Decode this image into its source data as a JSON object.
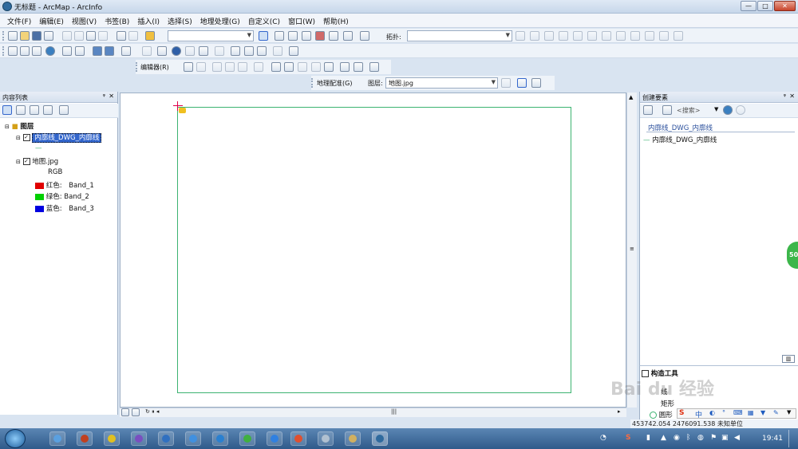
{
  "window": {
    "title": "无标题 - ArcMap - ArcInfo",
    "min_label": "—",
    "max_label": "□",
    "close_label": "✕"
  },
  "menu": [
    "文件(F)",
    "编辑(E)",
    "视图(V)",
    "书签(B)",
    "插入(I)",
    "选择(S)",
    "地理处理(G)",
    "自定义(C)",
    "窗口(W)",
    "帮助(H)"
  ],
  "toolbar": {
    "scale_value": "",
    "topology_label": "拓扑:",
    "topology_value": "",
    "editor_label": "编辑器(R)",
    "georef_label": "地理配准(G)",
    "layer_label": "图层:",
    "layer_value": "地图.jpg"
  },
  "toc": {
    "header": "内容列表",
    "pin": "ᵠ",
    "close": "✕",
    "root_label": "图层",
    "layer1": {
      "name": "内廓线_DWG_内廓线",
      "symbol": "—"
    },
    "layer2": {
      "name": "地图.jpg",
      "rgb": "RGB",
      "bands": [
        {
          "label": "红色:",
          "band": "Band_1",
          "color": "#e00000"
        },
        {
          "label": "绿色:",
          "band": "Band_2",
          "color": "#00d000"
        },
        {
          "label": "蓝色:",
          "band": "Band_3",
          "color": "#0000e0"
        }
      ]
    }
  },
  "create_features": {
    "header": "创建要素",
    "search_placeholder": "<搜索>",
    "group_title": "内廓线_DWG_内廓线",
    "template": "内廓线_DWG_内廓线"
  },
  "construction_tools": {
    "header": "构造工具",
    "items": [
      "线",
      "矩形",
      "圆形"
    ]
  },
  "status": {
    "coords": "453742.054  2476091.538 未知单位"
  },
  "taskbar": {
    "clock": "19:41"
  },
  "overlay": {
    "side_badge": "50",
    "watermark": "Bai du 经验"
  },
  "colors": {
    "map_frame": "#3cb371",
    "accent": "#2f6a9e",
    "selection": "#3366cc"
  }
}
